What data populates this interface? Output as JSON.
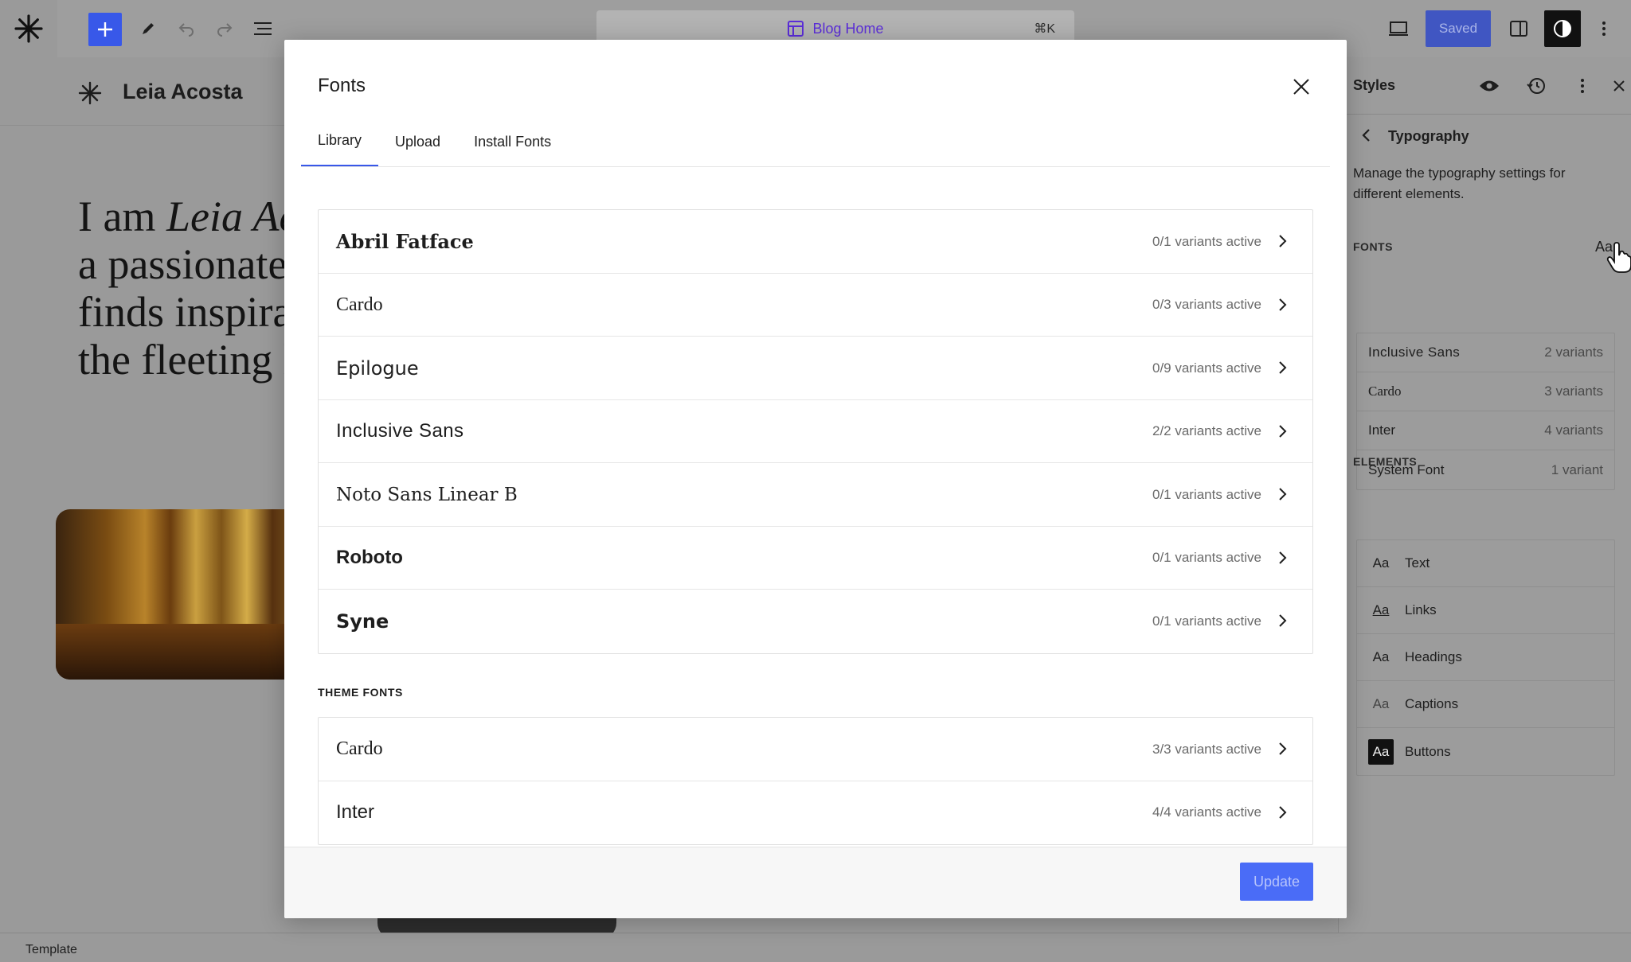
{
  "toolbar": {
    "document_title": "Blog Home",
    "shortcut": "⌘K",
    "saved_label": "Saved"
  },
  "canvas": {
    "site_name": "Leia Acosta",
    "hero_lines": [
      {
        "before": "I am ",
        "italic": "Leia Ac"
      },
      {
        "before": "a passionate",
        "italic": ""
      },
      {
        "before": "finds inspirat",
        "italic": ""
      },
      {
        "before": "the fleeting l",
        "italic": ""
      }
    ],
    "status": "Template"
  },
  "sidebar": {
    "title": "Styles",
    "subtitle": "Typography",
    "description": "Manage the typography settings for different elements.",
    "fonts_label": "FONTS",
    "aa_label": "Aa",
    "fonts": [
      {
        "name": "Inclusive Sans",
        "variants": "2 variants"
      },
      {
        "name": "Cardo",
        "variants": "3 variants"
      },
      {
        "name": "Inter",
        "variants": "4 variants"
      },
      {
        "name": "System Font",
        "variants": "1 variant"
      }
    ],
    "elements_label": "ELEMENTS",
    "elements": [
      {
        "aa": "Aa",
        "label": "Text"
      },
      {
        "aa": "Aa",
        "label": "Links"
      },
      {
        "aa": "Aa",
        "label": "Headings"
      },
      {
        "aa": "Aa",
        "label": "Captions"
      },
      {
        "aa": "Aa",
        "label": "Buttons"
      }
    ]
  },
  "modal": {
    "title": "Fonts",
    "tabs": [
      {
        "label": "Library"
      },
      {
        "label": "Upload"
      },
      {
        "label": "Install Fonts"
      }
    ],
    "library_fonts": [
      {
        "name": "Abril Fatface",
        "status": "0/1 variants active"
      },
      {
        "name": "Cardo",
        "status": "0/3 variants active"
      },
      {
        "name": "Epilogue",
        "status": "0/9 variants active"
      },
      {
        "name": "Inclusive Sans",
        "status": "2/2 variants active"
      },
      {
        "name": "Noto Sans Linear B",
        "status": "0/1 variants active"
      },
      {
        "name": "Roboto",
        "status": "0/1 variants active"
      },
      {
        "name": "Syne",
        "status": "0/1 variants active"
      }
    ],
    "theme_fonts_label": "THEME FONTS",
    "theme_fonts": [
      {
        "name": "Cardo",
        "status": "3/3 variants active"
      },
      {
        "name": "Inter",
        "status": "4/4 variants active"
      }
    ],
    "update_label": "Update"
  }
}
